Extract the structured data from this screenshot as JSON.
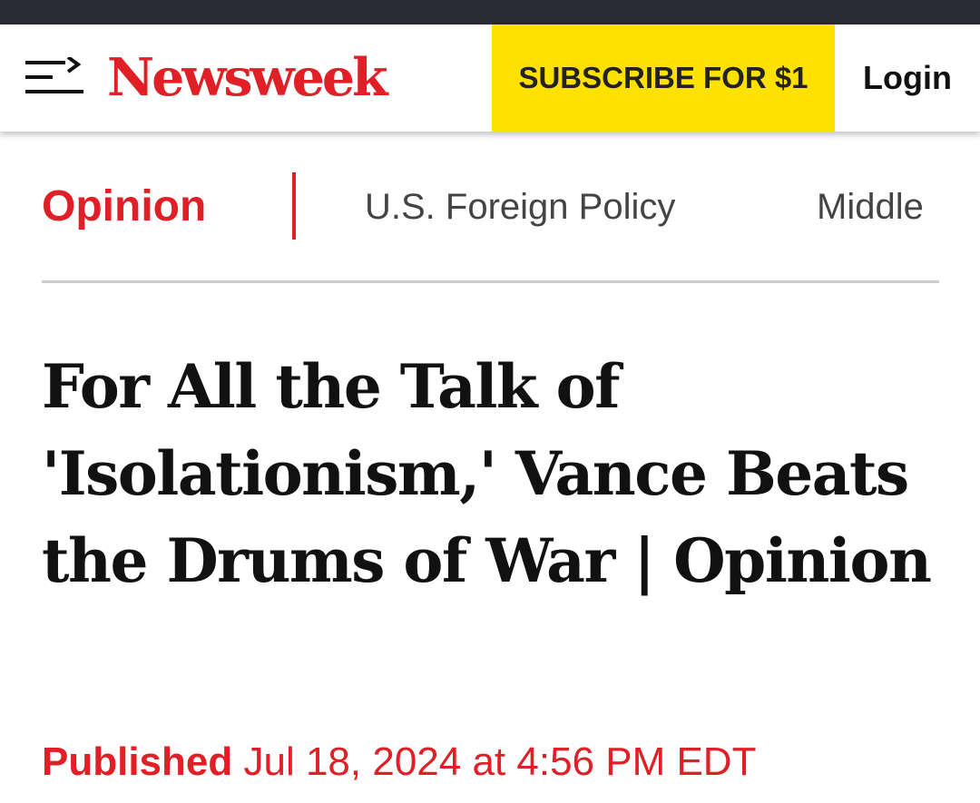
{
  "header": {
    "logo": "Newsweek",
    "subscribe_label": "SUBSCRIBE FOR $1",
    "login_label": "Login",
    "menu_icon": "hamburger-arrow-icon"
  },
  "subnav": {
    "section": "Opinion",
    "topics": [
      "U.S. Foreign Policy",
      "Middle"
    ]
  },
  "article": {
    "headline": "For All the Talk of 'Isolationism,' Vance Beats the Drums of War | Opinion",
    "published_label": "Published",
    "published_date": "Jul 18, 2024 at 4:56 PM EDT"
  },
  "colors": {
    "brand_red": "#e01f26",
    "subscribe_yellow": "#ffe100",
    "top_bar": "#2a2a35"
  }
}
